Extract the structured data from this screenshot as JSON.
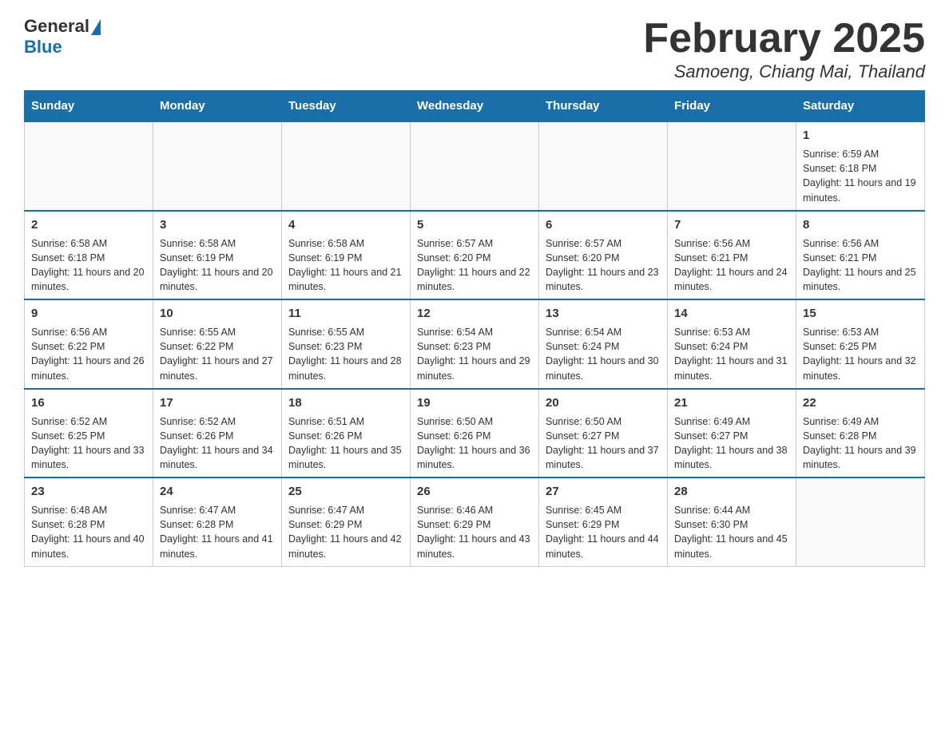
{
  "logo": {
    "general": "General",
    "blue": "Blue"
  },
  "title": "February 2025",
  "location": "Samoeng, Chiang Mai, Thailand",
  "days_of_week": [
    "Sunday",
    "Monday",
    "Tuesday",
    "Wednesday",
    "Thursday",
    "Friday",
    "Saturday"
  ],
  "weeks": [
    [
      {
        "day": "",
        "info": ""
      },
      {
        "day": "",
        "info": ""
      },
      {
        "day": "",
        "info": ""
      },
      {
        "day": "",
        "info": ""
      },
      {
        "day": "",
        "info": ""
      },
      {
        "day": "",
        "info": ""
      },
      {
        "day": "1",
        "info": "Sunrise: 6:59 AM\nSunset: 6:18 PM\nDaylight: 11 hours and 19 minutes."
      }
    ],
    [
      {
        "day": "2",
        "info": "Sunrise: 6:58 AM\nSunset: 6:18 PM\nDaylight: 11 hours and 20 minutes."
      },
      {
        "day": "3",
        "info": "Sunrise: 6:58 AM\nSunset: 6:19 PM\nDaylight: 11 hours and 20 minutes."
      },
      {
        "day": "4",
        "info": "Sunrise: 6:58 AM\nSunset: 6:19 PM\nDaylight: 11 hours and 21 minutes."
      },
      {
        "day": "5",
        "info": "Sunrise: 6:57 AM\nSunset: 6:20 PM\nDaylight: 11 hours and 22 minutes."
      },
      {
        "day": "6",
        "info": "Sunrise: 6:57 AM\nSunset: 6:20 PM\nDaylight: 11 hours and 23 minutes."
      },
      {
        "day": "7",
        "info": "Sunrise: 6:56 AM\nSunset: 6:21 PM\nDaylight: 11 hours and 24 minutes."
      },
      {
        "day": "8",
        "info": "Sunrise: 6:56 AM\nSunset: 6:21 PM\nDaylight: 11 hours and 25 minutes."
      }
    ],
    [
      {
        "day": "9",
        "info": "Sunrise: 6:56 AM\nSunset: 6:22 PM\nDaylight: 11 hours and 26 minutes."
      },
      {
        "day": "10",
        "info": "Sunrise: 6:55 AM\nSunset: 6:22 PM\nDaylight: 11 hours and 27 minutes."
      },
      {
        "day": "11",
        "info": "Sunrise: 6:55 AM\nSunset: 6:23 PM\nDaylight: 11 hours and 28 minutes."
      },
      {
        "day": "12",
        "info": "Sunrise: 6:54 AM\nSunset: 6:23 PM\nDaylight: 11 hours and 29 minutes."
      },
      {
        "day": "13",
        "info": "Sunrise: 6:54 AM\nSunset: 6:24 PM\nDaylight: 11 hours and 30 minutes."
      },
      {
        "day": "14",
        "info": "Sunrise: 6:53 AM\nSunset: 6:24 PM\nDaylight: 11 hours and 31 minutes."
      },
      {
        "day": "15",
        "info": "Sunrise: 6:53 AM\nSunset: 6:25 PM\nDaylight: 11 hours and 32 minutes."
      }
    ],
    [
      {
        "day": "16",
        "info": "Sunrise: 6:52 AM\nSunset: 6:25 PM\nDaylight: 11 hours and 33 minutes."
      },
      {
        "day": "17",
        "info": "Sunrise: 6:52 AM\nSunset: 6:26 PM\nDaylight: 11 hours and 34 minutes."
      },
      {
        "day": "18",
        "info": "Sunrise: 6:51 AM\nSunset: 6:26 PM\nDaylight: 11 hours and 35 minutes."
      },
      {
        "day": "19",
        "info": "Sunrise: 6:50 AM\nSunset: 6:26 PM\nDaylight: 11 hours and 36 minutes."
      },
      {
        "day": "20",
        "info": "Sunrise: 6:50 AM\nSunset: 6:27 PM\nDaylight: 11 hours and 37 minutes."
      },
      {
        "day": "21",
        "info": "Sunrise: 6:49 AM\nSunset: 6:27 PM\nDaylight: 11 hours and 38 minutes."
      },
      {
        "day": "22",
        "info": "Sunrise: 6:49 AM\nSunset: 6:28 PM\nDaylight: 11 hours and 39 minutes."
      }
    ],
    [
      {
        "day": "23",
        "info": "Sunrise: 6:48 AM\nSunset: 6:28 PM\nDaylight: 11 hours and 40 minutes."
      },
      {
        "day": "24",
        "info": "Sunrise: 6:47 AM\nSunset: 6:28 PM\nDaylight: 11 hours and 41 minutes."
      },
      {
        "day": "25",
        "info": "Sunrise: 6:47 AM\nSunset: 6:29 PM\nDaylight: 11 hours and 42 minutes."
      },
      {
        "day": "26",
        "info": "Sunrise: 6:46 AM\nSunset: 6:29 PM\nDaylight: 11 hours and 43 minutes."
      },
      {
        "day": "27",
        "info": "Sunrise: 6:45 AM\nSunset: 6:29 PM\nDaylight: 11 hours and 44 minutes."
      },
      {
        "day": "28",
        "info": "Sunrise: 6:44 AM\nSunset: 6:30 PM\nDaylight: 11 hours and 45 minutes."
      },
      {
        "day": "",
        "info": ""
      }
    ]
  ]
}
